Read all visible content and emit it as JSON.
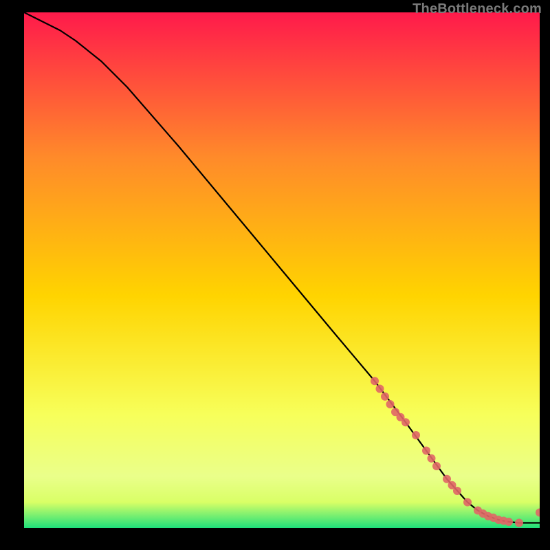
{
  "watermark": "TheBottleneck.com",
  "chart_data": {
    "type": "line",
    "title": "",
    "xlabel": "",
    "ylabel": "",
    "xlim": [
      0,
      100
    ],
    "ylim": [
      0,
      100
    ],
    "grid": false,
    "legend": false,
    "background_gradient": {
      "top": "#ff1a4b",
      "mid_upper": "#ff8a2a",
      "mid": "#ffd400",
      "mid_lower": "#f7ff5a",
      "pregreen": "#d9ff66",
      "green": "#1fe07a"
    },
    "series": [
      {
        "name": "curve",
        "color": "#000000",
        "style": "line",
        "x": [
          0,
          2,
          4,
          7,
          10,
          15,
          20,
          30,
          40,
          50,
          60,
          68,
          74,
          78,
          82,
          86,
          88,
          90,
          92,
          94,
          96,
          98,
          100
        ],
        "y": [
          100,
          99,
          98,
          96.5,
          94.5,
          90.5,
          85.5,
          74,
          62,
          50,
          38,
          28.5,
          20.5,
          15,
          9.5,
          5,
          3.4,
          2.3,
          1.6,
          1.2,
          1.0,
          1.0,
          1.0
        ]
      },
      {
        "name": "points",
        "color": "#e06666",
        "style": "scatter",
        "x": [
          68,
          69,
          70,
          71,
          72,
          73,
          74,
          76,
          78,
          79,
          80,
          82,
          83,
          84,
          86,
          88,
          89,
          90,
          91,
          92,
          93,
          94,
          96,
          100
        ],
        "y": [
          28.5,
          27,
          25.5,
          24,
          22.5,
          21.5,
          20.5,
          18,
          15,
          13.5,
          12,
          9.5,
          8.3,
          7.2,
          5,
          3.4,
          2.8,
          2.3,
          2.0,
          1.6,
          1.4,
          1.2,
          1.0,
          3.0
        ]
      }
    ]
  }
}
